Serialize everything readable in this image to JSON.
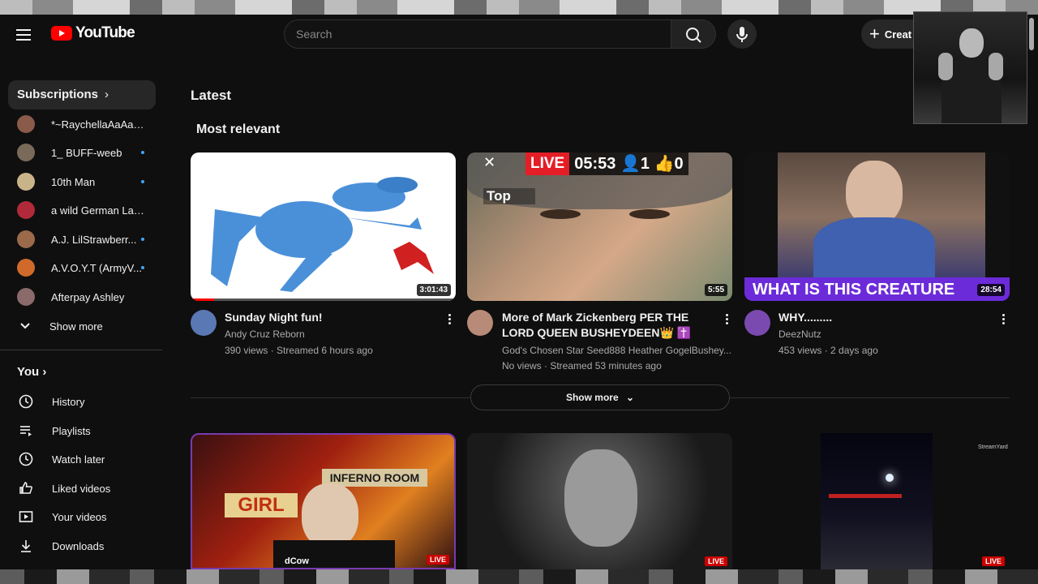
{
  "header": {
    "logo_text": "YouTube",
    "search_placeholder": "Search",
    "create_label": "Creat"
  },
  "sidebar": {
    "subscriptions_label": "Subscriptions",
    "subscriptions": [
      {
        "name": "*~RaychellaAaAaA...",
        "dot": false,
        "color": "#8a5a4a"
      },
      {
        "name": "1_ BUFF-weeb",
        "dot": true,
        "color": "#7a6a5a"
      },
      {
        "name": "10th Man",
        "dot": true,
        "color": "#c9b48a"
      },
      {
        "name": "a wild German Lady...",
        "dot": false,
        "color": "#b02a3a"
      },
      {
        "name": "A.J. LilStrawberr...",
        "dot": true,
        "color": "#9a6a4a"
      },
      {
        "name": "A.V.O.Y.T (ArmyV...",
        "dot": true,
        "color": "#d06a2a"
      },
      {
        "name": "Afterpay Ashley",
        "dot": false,
        "color": "#8a6a6a"
      }
    ],
    "show_more": "Show more",
    "you_label": "You",
    "nav": [
      {
        "label": "History",
        "icon": "history-icon"
      },
      {
        "label": "Playlists",
        "icon": "playlists-icon"
      },
      {
        "label": "Watch later",
        "icon": "watch-later-icon"
      },
      {
        "label": "Liked videos",
        "icon": "like-icon"
      },
      {
        "label": "Your videos",
        "icon": "your-videos-icon"
      },
      {
        "label": "Downloads",
        "icon": "download-icon"
      }
    ]
  },
  "main": {
    "title": "Latest",
    "section": "Most relevant",
    "show_more": "Show more",
    "videos": [
      {
        "title": "Sunday Night fun!",
        "channel": "Andy Cruz Reborn",
        "meta": "390 views · Streamed 6 hours ago",
        "duration": "3:01:43",
        "progress": 0.09
      },
      {
        "title": "More of Mark Zickenberg PER THE LORD QUEEN BUSHEYDEEN👑 ✝️",
        "channel": "God's Chosen Star Seed888 Heather GogelBushey...",
        "meta": "No views · Streamed 53 minutes ago",
        "duration": "5:55",
        "overlay": {
          "live": "LIVE",
          "time": "05:53",
          "viewers": "1",
          "likes": "0",
          "close": "✕",
          "top": "Top"
        }
      },
      {
        "title": "WHY.........",
        "channel": "DeezNutz",
        "meta": "453 views · 2 days ago",
        "duration": "28:54",
        "banner": "WHAT IS THIS CREATURE"
      }
    ],
    "row2": [
      {
        "badge": "LIVE",
        "sign_text": "INFERNO ROOM",
        "sign_text2": "GIRL",
        "watermark": "dCow"
      },
      {
        "badge": "LIVE"
      },
      {
        "badge": "LIVE",
        "watermark": "StreamYard"
      }
    ]
  }
}
